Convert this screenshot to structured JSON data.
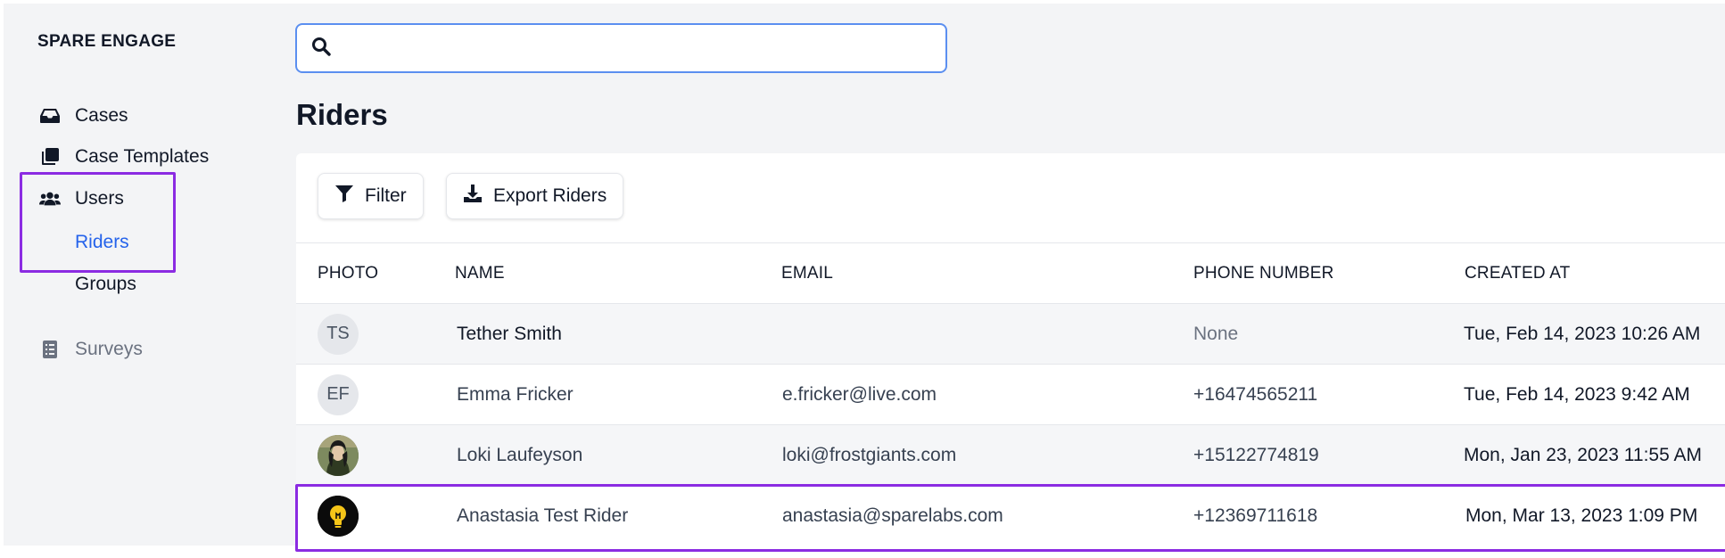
{
  "app": {
    "brand": "SPARE ENGAGE"
  },
  "sidebar": {
    "items": [
      {
        "label": "Cases",
        "icon": "inbox-icon"
      },
      {
        "label": "Case Templates",
        "icon": "copy-icon"
      },
      {
        "label": "Users",
        "icon": "users-icon"
      },
      {
        "label": "Surveys",
        "icon": "list-icon"
      }
    ],
    "users_sub": [
      {
        "label": "Riders",
        "active": true
      },
      {
        "label": "Groups",
        "active": false
      }
    ]
  },
  "search": {
    "placeholder": "",
    "value": ""
  },
  "page": {
    "title": "Riders"
  },
  "toolbar": {
    "filter_label": "Filter",
    "export_label": "Export Riders"
  },
  "table": {
    "headers": [
      "PHOTO",
      "NAME",
      "EMAIL",
      "PHONE NUMBER",
      "CREATED AT"
    ],
    "rows": [
      {
        "initials": "TS",
        "name": "Tether Smith",
        "email": "",
        "phone": "None",
        "created": "Tue, Feb 14, 2023 10:26 AM"
      },
      {
        "initials": "EF",
        "name": "Emma Fricker",
        "email": "e.fricker@live.com",
        "phone": "+16474565211",
        "created": "Tue, Feb 14, 2023 9:42 AM"
      },
      {
        "initials": "",
        "name": "Loki Laufeyson",
        "email": "loki@frostgiants.com",
        "phone": "+15122774819",
        "created": "Mon, Jan 23, 2023 11:55 AM"
      },
      {
        "initials": "",
        "name": "Anastasia Test Rider",
        "email": "anastasia@sparelabs.com",
        "phone": "+12369711618",
        "created": "Mon, Mar 13, 2023 1:09 PM"
      }
    ]
  },
  "colors": {
    "accent": "#2563eb",
    "highlight": "#8b2be2",
    "search_border": "#5b8ff0"
  }
}
